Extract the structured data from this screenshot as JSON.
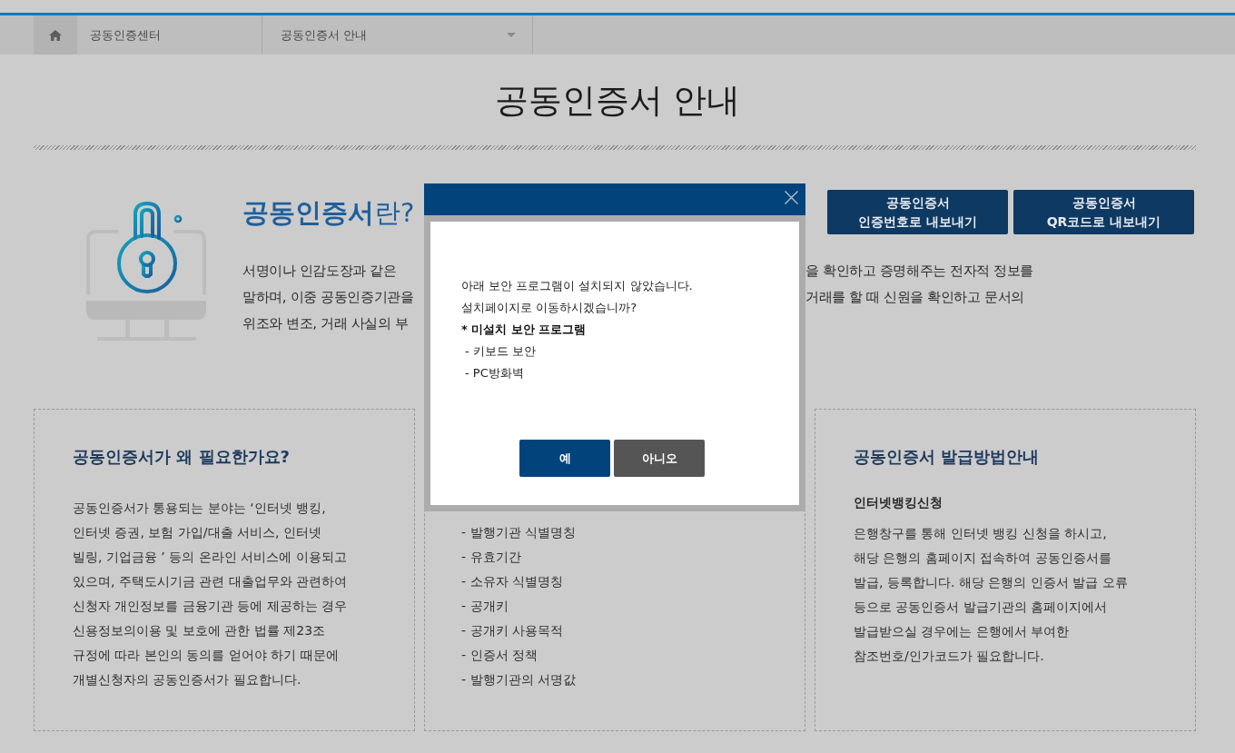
{
  "nav": {
    "section": "공동인증센터",
    "page": "공동인증서 안내"
  },
  "page_title": "공동인증서 안내",
  "intro": {
    "title": "**공동인증서**란?",
    "text_lines": [
      {
        "left": "서명이나 인감도장과 같은",
        "right": "을 확인하고 증명해주는 전자적 정보를"
      },
      {
        "left": "말하며, 이중 공동인증기관을",
        "right": "거래를 할 때 신원을 확인하고 문서의"
      },
      {
        "left": "위조와 변조, 거래 사실의 부"
      }
    ],
    "buttons": [
      "공동인증서\n인증번호로 내보내기",
      "공동인증서\nQR코드로 내보내기"
    ]
  },
  "cards": [
    {
      "kind": "text",
      "title": "공동인증서가 왜 필요한가요?",
      "body": "공동인증서가 통용되는 분야는 ‘인터넷 뱅킹,\n인터넷 증권, 보험 가입/대출 서비스, 인터넷\n빌링, 기업금융 ’ 등의 온라인 서비스에 이용되고\n있으며, 주택도시기금 관련 대출업무와 관련하여\n신청자 개인정보를 금융기관 등에 제공하는 경우\n신용정보의이용 및 보호에 관한 법률 제23조\n규정에 따라 본인의 동의를 얻어야 하기 때문에\n개별신청자의 공동인증서가 필요합니다."
    },
    {
      "kind": "list",
      "items": [
        "- 발행기관 식별명칭",
        "- 유효기간",
        "- 소유자 식별명칭",
        "- 공개키",
        "- 공개키 사용목적",
        "- 인증서 정책",
        "- 발행기관의 서명값"
      ]
    },
    {
      "kind": "text",
      "title": "공동인증서 발급방법안내",
      "subtitle": "인터넷뱅킹신청",
      "body": "은행창구를 통해 인터넷 뱅킹 신청을 하시고,\n해당 은행의 홈페이지 접속하여 공동인증서를\n발급, 등록합니다. 해당 은행의 인증서 발급 오류\n등으로 공동인증서 발급기관의 홈페이지에서\n발급받으실 경우에는 은행에서 부여한\n참조번호/인가코드가 필요합니다."
    }
  ],
  "dialog": {
    "message": "아래 보안 프로그램이 설치되지 않았습니다.\n설치페이지로 이동하시겠습니까?",
    "list_title": "* 미설치 보안 프로그램",
    "list_items": [
      "- 키보드 보안",
      "- PC방화벽"
    ],
    "buttons": [
      {
        "kind": "primary",
        "label": "예"
      },
      {
        "kind": "secondary",
        "label": "아니오"
      }
    ]
  }
}
